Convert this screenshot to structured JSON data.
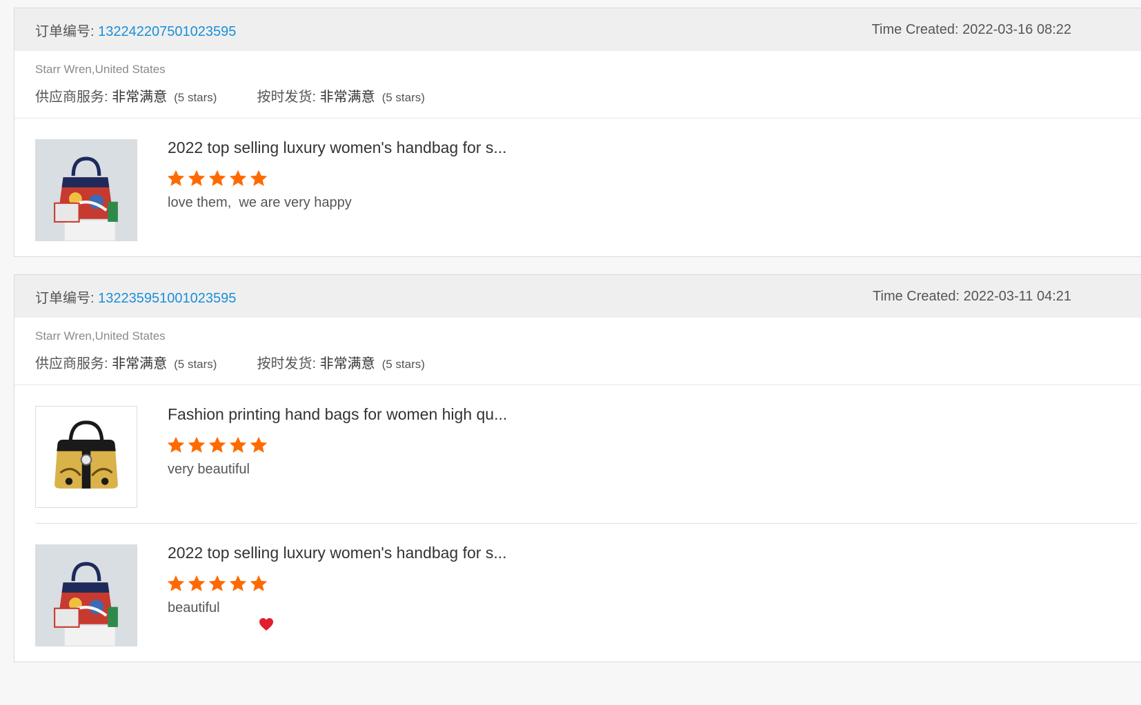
{
  "colors": {
    "link": "#1a8fd6",
    "star": "#ff6a00",
    "heart": "#e0202a",
    "header_bg": "#efefef"
  },
  "orders": [
    {
      "order_label": "订单编号: ",
      "order_number": "132242207501023595",
      "time_created": "Time Created: 2022-03-16 08:22",
      "buyer": "Starr Wren,United States",
      "ratings": [
        {
          "label": "供应商服务: ",
          "value": "非常满意",
          "stars_text": "(5 stars)"
        },
        {
          "label": "按时发货: ",
          "value": "非常满意",
          "stars_text": "(5 stars)"
        }
      ],
      "products": [
        {
          "title": "2022 top selling luxury women's handbag for s...",
          "rating": 5,
          "comment": "love them,  we are very happy",
          "image": "handbag-colorful-icon"
        }
      ]
    },
    {
      "order_label": "订单编号: ",
      "order_number": "132235951001023595",
      "time_created": "Time Created: 2022-03-11 04:21",
      "buyer": "Starr Wren,United States",
      "ratings": [
        {
          "label": "供应商服务: ",
          "value": "非常满意",
          "stars_text": "(5 stars)"
        },
        {
          "label": "按时发货: ",
          "value": "非常满意",
          "stars_text": "(5 stars)"
        }
      ],
      "products": [
        {
          "title": "Fashion printing hand bags for women high qu...",
          "rating": 5,
          "comment": "very beautiful",
          "image": "handbag-gold-icon"
        },
        {
          "title": "2022 top selling luxury women's handbag for s...",
          "rating": 5,
          "comment": "beautiful",
          "image": "handbag-colorful-icon",
          "emoji": "heart-icon"
        }
      ]
    }
  ]
}
